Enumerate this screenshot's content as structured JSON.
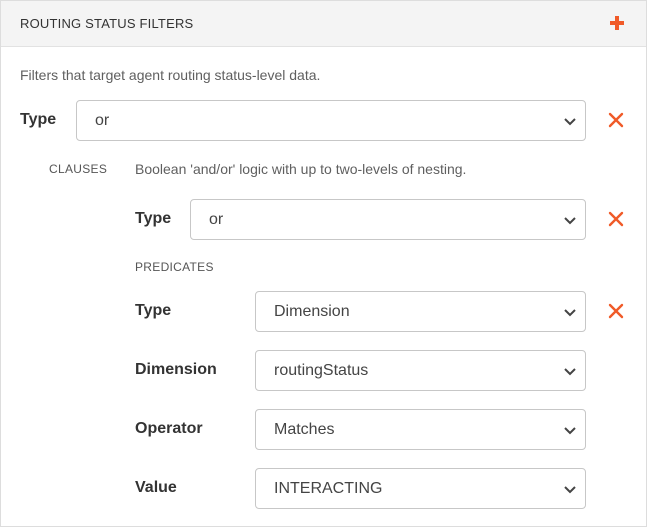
{
  "panel": {
    "title": "ROUTING STATUS FILTERS",
    "add_icon": "plus-icon",
    "description": "Filters that target agent routing status-level data."
  },
  "filter": {
    "type_label": "Type",
    "type_value": "or",
    "remove_icon": "close-icon"
  },
  "clauses": {
    "label": "CLAUSES",
    "description": "Boolean 'and/or' logic with up to two-levels of nesting.",
    "type_label": "Type",
    "type_value": "or"
  },
  "predicates": {
    "label": "PREDICATES",
    "type_label": "Type",
    "type_value": "Dimension",
    "dimension_label": "Dimension",
    "dimension_value": "routingStatus",
    "operator_label": "Operator",
    "operator_value": "Matches",
    "value_label": "Value",
    "value_value": "INTERACTING"
  },
  "colors": {
    "accent": "#f05a28",
    "header_bg": "#f4f4f4",
    "border": "#c7c7c7"
  }
}
